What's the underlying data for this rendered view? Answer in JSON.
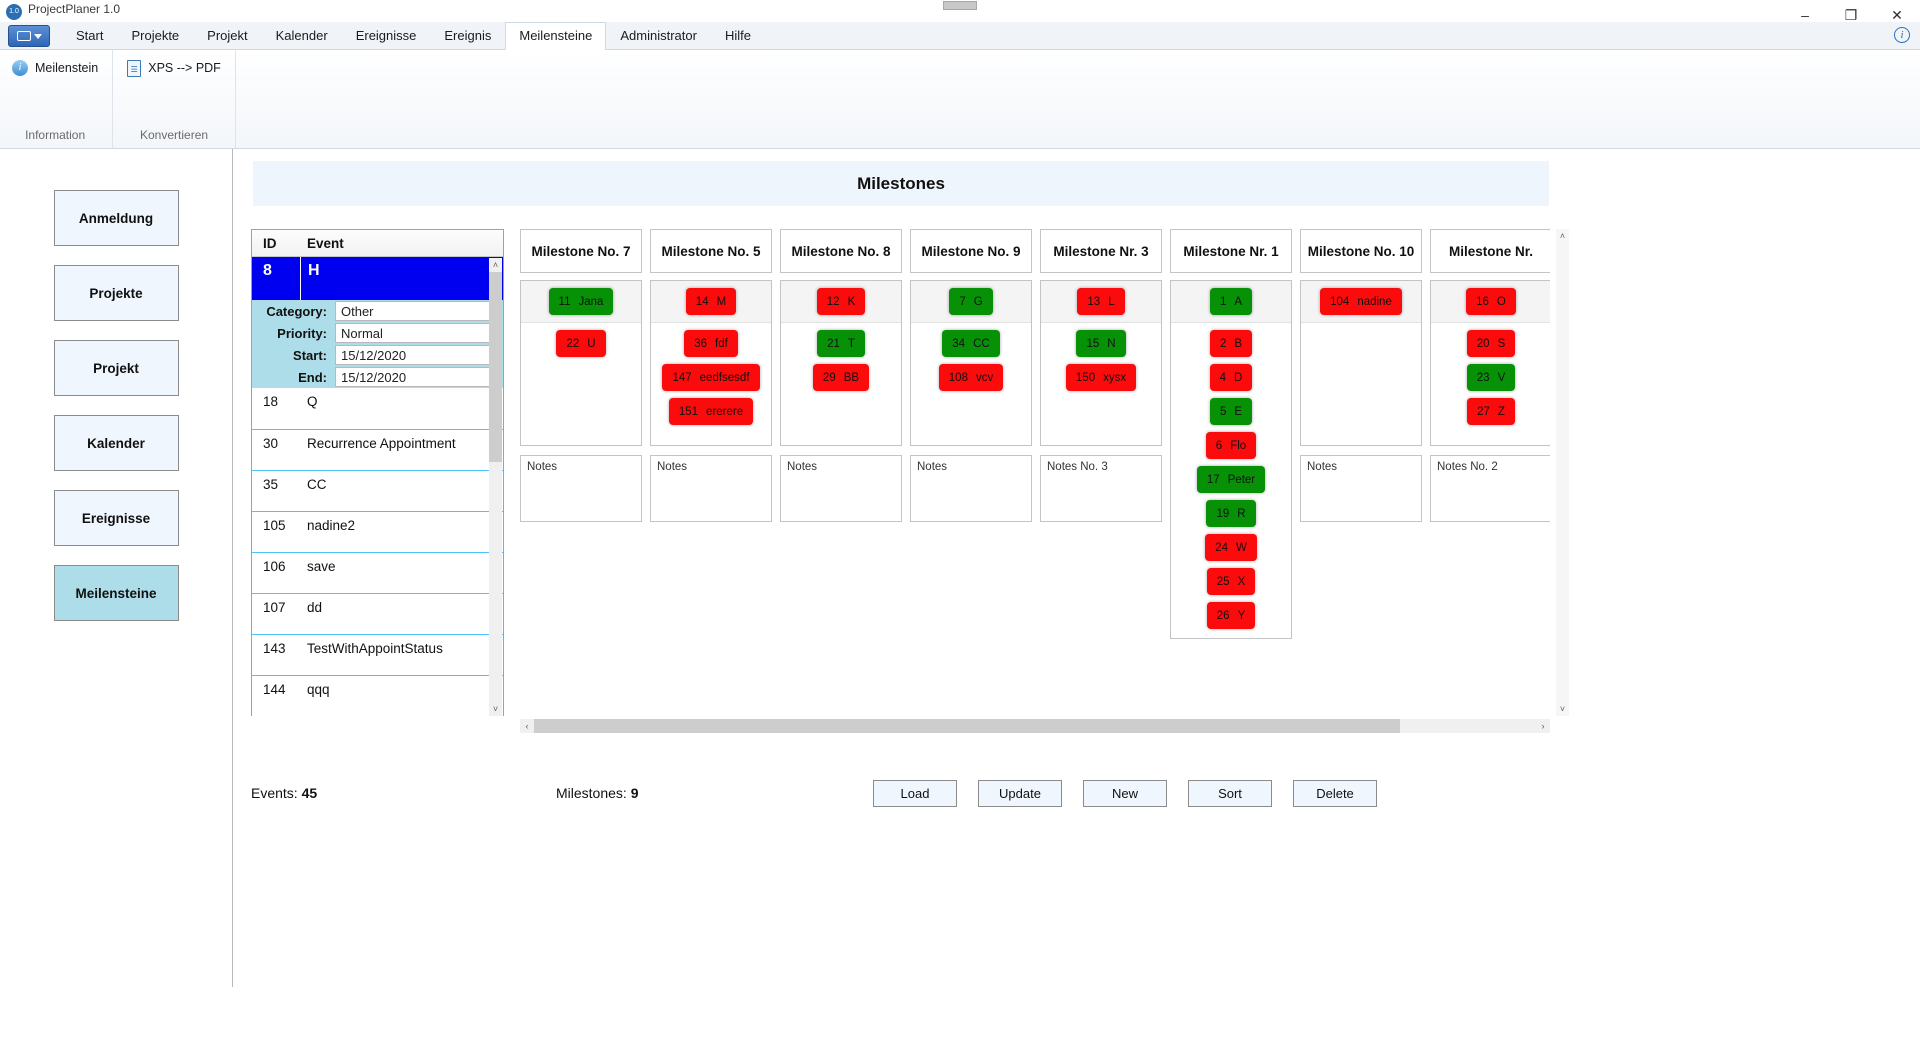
{
  "window": {
    "title": "ProjectPlaner 1.0",
    "minimize": "–",
    "maximize": "❐",
    "close": "✕",
    "app_icon_label": "1.0"
  },
  "ribbon": {
    "tabs": [
      {
        "label": "Start",
        "active": false
      },
      {
        "label": "Projekte",
        "active": false
      },
      {
        "label": "Projekt",
        "active": false
      },
      {
        "label": "Kalender",
        "active": false
      },
      {
        "label": "Ereignisse",
        "active": false
      },
      {
        "label": "Ereignis",
        "active": false
      },
      {
        "label": "Meilensteine",
        "active": true
      },
      {
        "label": "Administrator",
        "active": false
      },
      {
        "label": "Hilfe",
        "active": false
      }
    ],
    "info_icon": "i",
    "groups": [
      {
        "group_label": "Information",
        "items": [
          {
            "label": "Meilenstein",
            "icon": "info-icon"
          }
        ]
      },
      {
        "group_label": "Konvertieren",
        "items": [
          {
            "label": "XPS --> PDF",
            "icon": "document-icon"
          }
        ]
      }
    ]
  },
  "sidebar": {
    "items": [
      {
        "label": "Anmeldung",
        "active": false
      },
      {
        "label": "Projekte",
        "active": false
      },
      {
        "label": "Projekt",
        "active": false
      },
      {
        "label": "Kalender",
        "active": false
      },
      {
        "label": "Ereignisse",
        "active": false
      },
      {
        "label": "Meilensteine",
        "active": true
      }
    ]
  },
  "main": {
    "banner_title": "Milestones"
  },
  "events_list": {
    "columns": [
      "ID",
      "Event"
    ],
    "selected": {
      "id": "8",
      "event": "H",
      "detail": [
        {
          "label": "Category:",
          "value": "Other"
        },
        {
          "label": "Priority:",
          "value": "Normal"
        },
        {
          "label": "Start:",
          "value": "15/12/2020"
        },
        {
          "label": "End:",
          "value": "15/12/2020"
        }
      ]
    },
    "rows": [
      {
        "id": "18",
        "event": "Q"
      },
      {
        "id": "30",
        "event": "Recurrence Appointment"
      },
      {
        "id": "35",
        "event": "CC"
      },
      {
        "id": "105",
        "event": "nadine2"
      },
      {
        "id": "106",
        "event": "save"
      },
      {
        "id": "107",
        "event": "dd"
      },
      {
        "id": "143",
        "event": "TestWithAppointStatus"
      },
      {
        "id": "144",
        "event": "qqq"
      }
    ],
    "scroll_up_icon": "˄",
    "scroll_down_icon": "˅"
  },
  "board": {
    "scroll_left_icon": "‹",
    "scroll_right_icon": "›",
    "scroll_up_icon": "˄",
    "scroll_down_icon": "˅",
    "columns": [
      {
        "title": "Milestone No. 7",
        "notes": "Notes",
        "items": [
          {
            "id": "11",
            "name": "Jana",
            "color": "green"
          },
          {
            "id": "22",
            "name": "U",
            "color": "red"
          }
        ]
      },
      {
        "title": "Milestone No. 5",
        "notes": "Notes",
        "items": [
          {
            "id": "14",
            "name": "M",
            "color": "red"
          },
          {
            "id": "36",
            "name": "fdf",
            "color": "red"
          },
          {
            "id": "147",
            "name": "eedfsesdf",
            "color": "red"
          },
          {
            "id": "151",
            "name": "ererere",
            "color": "red"
          }
        ]
      },
      {
        "title": "Milestone No. 8",
        "notes": "Notes",
        "items": [
          {
            "id": "12",
            "name": "K",
            "color": "red"
          },
          {
            "id": "21",
            "name": "T",
            "color": "green"
          },
          {
            "id": "29",
            "name": "BB",
            "color": "red"
          }
        ]
      },
      {
        "title": "Milestone No. 9",
        "notes": "Notes",
        "items": [
          {
            "id": "7",
            "name": "G",
            "color": "green"
          },
          {
            "id": "34",
            "name": "CC",
            "color": "green"
          },
          {
            "id": "108",
            "name": "vcv",
            "color": "red"
          }
        ]
      },
      {
        "title": "Milestone Nr. 3",
        "notes": "Notes No. 3",
        "items": [
          {
            "id": "13",
            "name": "L",
            "color": "red"
          },
          {
            "id": "15",
            "name": "N",
            "color": "green"
          },
          {
            "id": "150",
            "name": "xysx",
            "color": "red"
          }
        ]
      },
      {
        "title": "Milestone Nr. 1",
        "notes": "",
        "items": [
          {
            "id": "1",
            "name": "A",
            "color": "green"
          },
          {
            "id": "2",
            "name": "B",
            "color": "red"
          },
          {
            "id": "4",
            "name": "D",
            "color": "red"
          },
          {
            "id": "5",
            "name": "E",
            "color": "green"
          },
          {
            "id": "6",
            "name": "Flo",
            "color": "red"
          },
          {
            "id": "17",
            "name": "Peter",
            "color": "green"
          },
          {
            "id": "19",
            "name": "R",
            "color": "green"
          },
          {
            "id": "24",
            "name": "W",
            "color": "red"
          },
          {
            "id": "25",
            "name": "X",
            "color": "red"
          },
          {
            "id": "26",
            "name": "Y",
            "color": "red"
          }
        ]
      },
      {
        "title": "Milestone No. 10",
        "notes": "Notes",
        "items": [
          {
            "id": "104",
            "name": "nadine",
            "color": "red"
          }
        ]
      },
      {
        "title": "Milestone Nr.",
        "notes": "Notes No. 2",
        "items": [
          {
            "id": "16",
            "name": "O",
            "color": "red"
          },
          {
            "id": "20",
            "name": "S",
            "color": "red"
          },
          {
            "id": "23",
            "name": "V",
            "color": "green"
          },
          {
            "id": "27",
            "name": "Z",
            "color": "red"
          }
        ]
      }
    ]
  },
  "footer": {
    "events_label": "Events:",
    "events_count": "45",
    "milestones_label": "Milestones:",
    "milestones_count": "9",
    "buttons": [
      {
        "label": "Load"
      },
      {
        "label": "Update"
      },
      {
        "label": "New"
      },
      {
        "label": "Sort"
      },
      {
        "label": "Delete"
      }
    ]
  },
  "colors": {
    "accent": "#2f66b8",
    "green": "#079107",
    "red": "#fb0b0b",
    "selected": "#0000f0",
    "active_nav": "#addde8"
  }
}
